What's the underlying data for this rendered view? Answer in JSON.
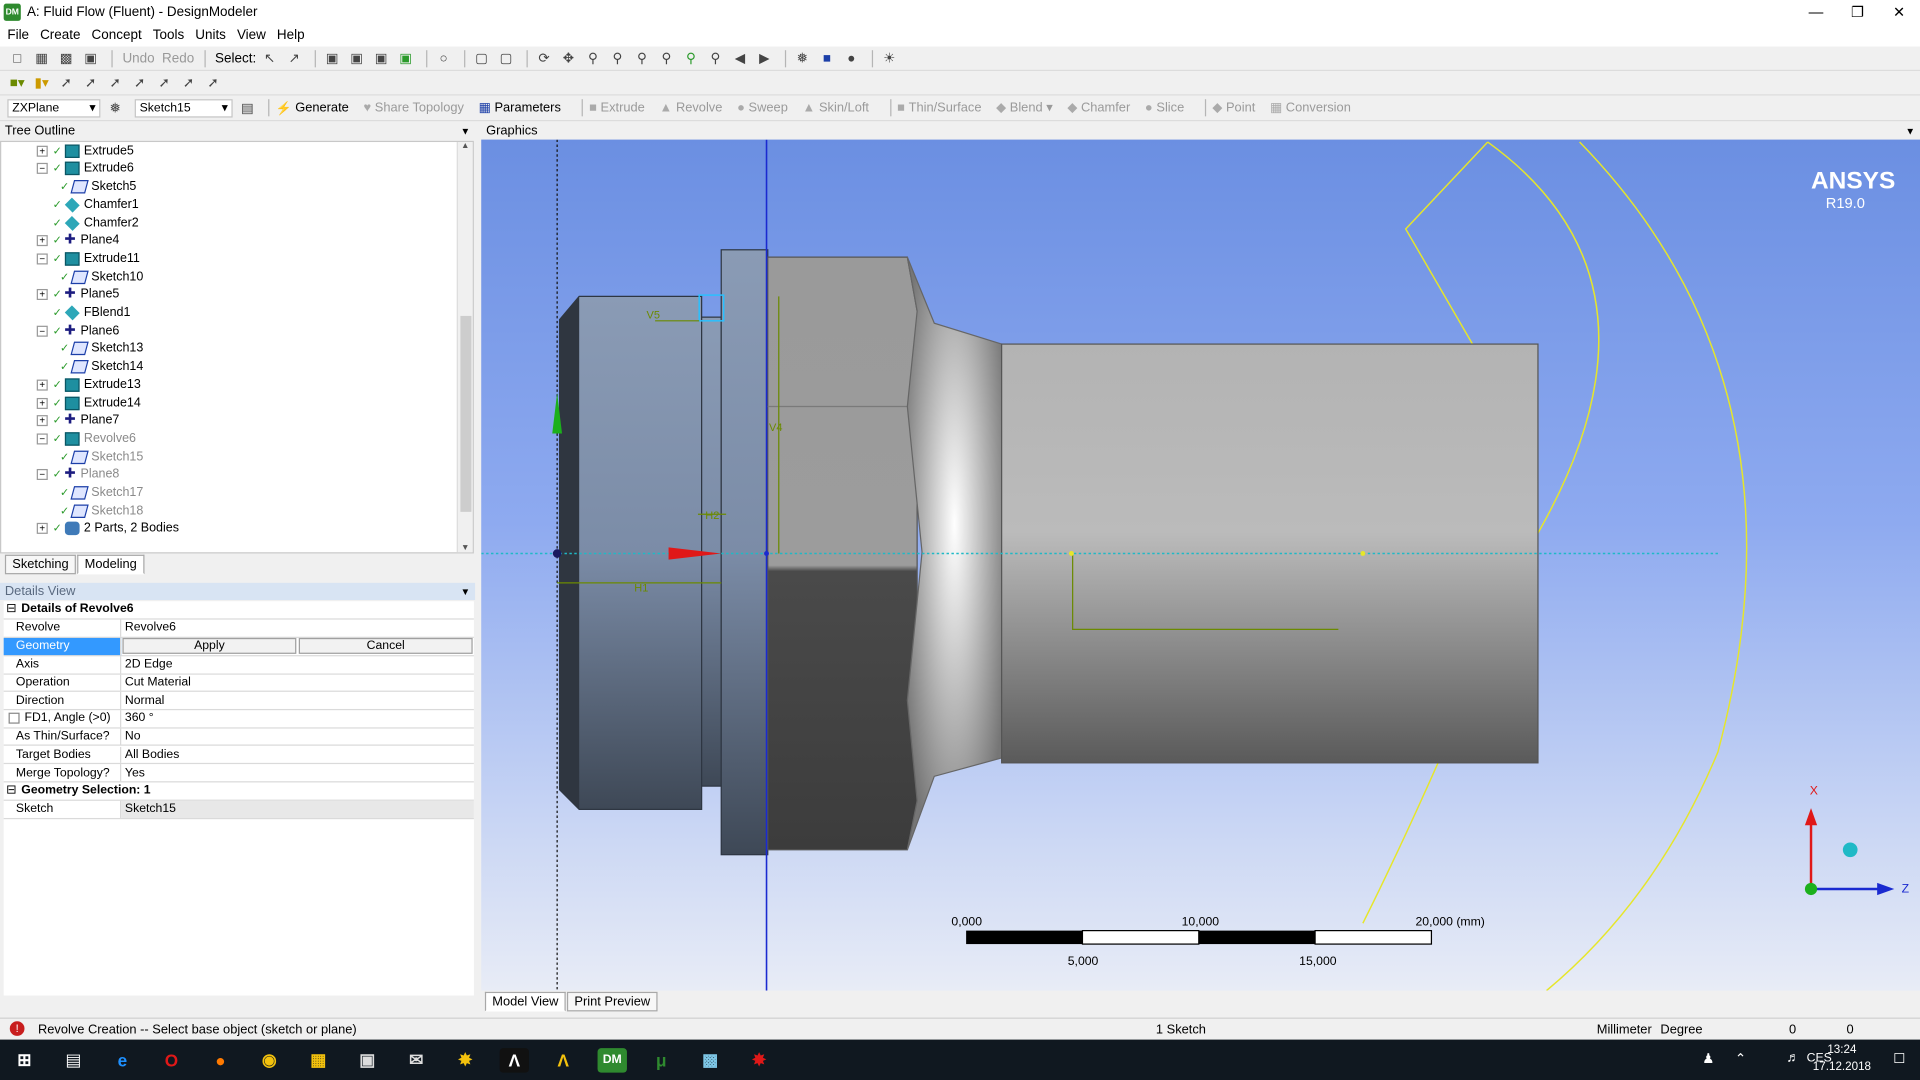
{
  "window": {
    "title": "A: Fluid Flow (Fluent) - DesignModeler",
    "app_badge": "DM"
  },
  "menu": [
    "File",
    "Create",
    "Concept",
    "Tools",
    "Units",
    "View",
    "Help"
  ],
  "toolbar1": {
    "undo": "Undo",
    "redo": "Redo",
    "select": "Select:"
  },
  "toolbar3": {
    "plane_value": "ZXPlane",
    "sketch_value": "Sketch15",
    "generate": "Generate",
    "share_topology": "Share Topology",
    "parameters": "Parameters",
    "extrude": "Extrude",
    "revolve": "Revolve",
    "sweep": "Sweep",
    "skin_loft": "Skin/Loft",
    "thin_surface": "Thin/Surface",
    "blend": "Blend",
    "chamfer": "Chamfer",
    "slice": "Slice",
    "point": "Point",
    "conversion": "Conversion"
  },
  "tree_outline": {
    "title": "Tree Outline",
    "items": [
      {
        "label": "Extrude5",
        "type": "ext",
        "pm": "+",
        "indent": 1,
        "gray": false
      },
      {
        "label": "Extrude6",
        "type": "ext",
        "pm": "-",
        "indent": 1,
        "gray": false
      },
      {
        "label": "Sketch5",
        "type": "sk",
        "pm": "",
        "indent": 2,
        "gray": false
      },
      {
        "label": "Chamfer1",
        "type": "ch",
        "pm": "",
        "indent": 1,
        "gray": false
      },
      {
        "label": "Chamfer2",
        "type": "ch",
        "pm": "",
        "indent": 1,
        "gray": false
      },
      {
        "label": "Plane4",
        "type": "pl",
        "pm": "+",
        "indent": 1,
        "gray": false
      },
      {
        "label": "Extrude11",
        "type": "ext",
        "pm": "-",
        "indent": 1,
        "gray": false
      },
      {
        "label": "Sketch10",
        "type": "sk",
        "pm": "",
        "indent": 2,
        "gray": false
      },
      {
        "label": "Plane5",
        "type": "pl",
        "pm": "+",
        "indent": 1,
        "gray": false
      },
      {
        "label": "FBlend1",
        "type": "ch",
        "pm": "",
        "indent": 1,
        "gray": false
      },
      {
        "label": "Plane6",
        "type": "pl",
        "pm": "-",
        "indent": 1,
        "gray": false
      },
      {
        "label": "Sketch13",
        "type": "sk",
        "pm": "",
        "indent": 2,
        "gray": false
      },
      {
        "label": "Sketch14",
        "type": "sk",
        "pm": "",
        "indent": 2,
        "gray": false
      },
      {
        "label": "Extrude13",
        "type": "ext",
        "pm": "+",
        "indent": 1,
        "gray": false
      },
      {
        "label": "Extrude14",
        "type": "ext",
        "pm": "+",
        "indent": 1,
        "gray": false
      },
      {
        "label": "Plane7",
        "type": "pl",
        "pm": "+",
        "indent": 1,
        "gray": false
      },
      {
        "label": "Revolve6",
        "type": "ext",
        "pm": "-",
        "indent": 1,
        "gray": true
      },
      {
        "label": "Sketch15",
        "type": "sk",
        "pm": "",
        "indent": 2,
        "gray": true
      },
      {
        "label": "Plane8",
        "type": "pl",
        "pm": "-",
        "indent": 1,
        "gray": true
      },
      {
        "label": "Sketch17",
        "type": "sk",
        "pm": "",
        "indent": 2,
        "gray": true
      },
      {
        "label": "Sketch18",
        "type": "sk",
        "pm": "",
        "indent": 2,
        "gray": true
      },
      {
        "label": "2 Parts, 2 Bodies",
        "type": "bd",
        "pm": "+",
        "indent": 0,
        "gray": false
      }
    ]
  },
  "tabs": {
    "sketching": "Sketching",
    "modeling": "Modeling"
  },
  "details_view": {
    "title": "Details View",
    "header": "Details of Revolve6",
    "revolve_label": "Revolve",
    "revolve_value": "Revolve6",
    "geometry_label": "Geometry",
    "apply": "Apply",
    "cancel": "Cancel",
    "rows": [
      {
        "k": "Axis",
        "v": "2D Edge"
      },
      {
        "k": "Operation",
        "v": "Cut Material"
      },
      {
        "k": "Direction",
        "v": "Normal"
      },
      {
        "k": "FD1, Angle (>0)",
        "v": "360 °"
      },
      {
        "k": "As Thin/Surface?",
        "v": "No"
      },
      {
        "k": "Target Bodies",
        "v": "All Bodies"
      },
      {
        "k": "Merge Topology?",
        "v": "Yes"
      }
    ],
    "geom_selection": "Geometry Selection: 1",
    "sketch_label": "Sketch",
    "sketch_value": "Sketch15"
  },
  "graphics": {
    "title": "Graphics",
    "brand": "ANSYS",
    "version": "R19.0",
    "scale_labels_top": [
      "0,000",
      "10,000",
      "20,000 (mm)"
    ],
    "scale_labels_bottom": [
      "5,000",
      "15,000"
    ],
    "axis_x": "X",
    "axis_z": "Z",
    "dimensions": [
      "V5",
      "V4",
      "H2",
      "H1"
    ]
  },
  "bottom_tabs": {
    "model_view": "Model View",
    "print_preview": "Print Preview"
  },
  "status": {
    "message": "Revolve Creation -- Select base object (sketch or plane)",
    "selection": "1 Sketch",
    "units_length": "Millimeter",
    "units_angle": "Degree",
    "val1": "0",
    "val2": "0"
  },
  "taskbar": {
    "time": "13:24",
    "date": "17.12.2018",
    "lang": "CES",
    "dm": "DM"
  }
}
